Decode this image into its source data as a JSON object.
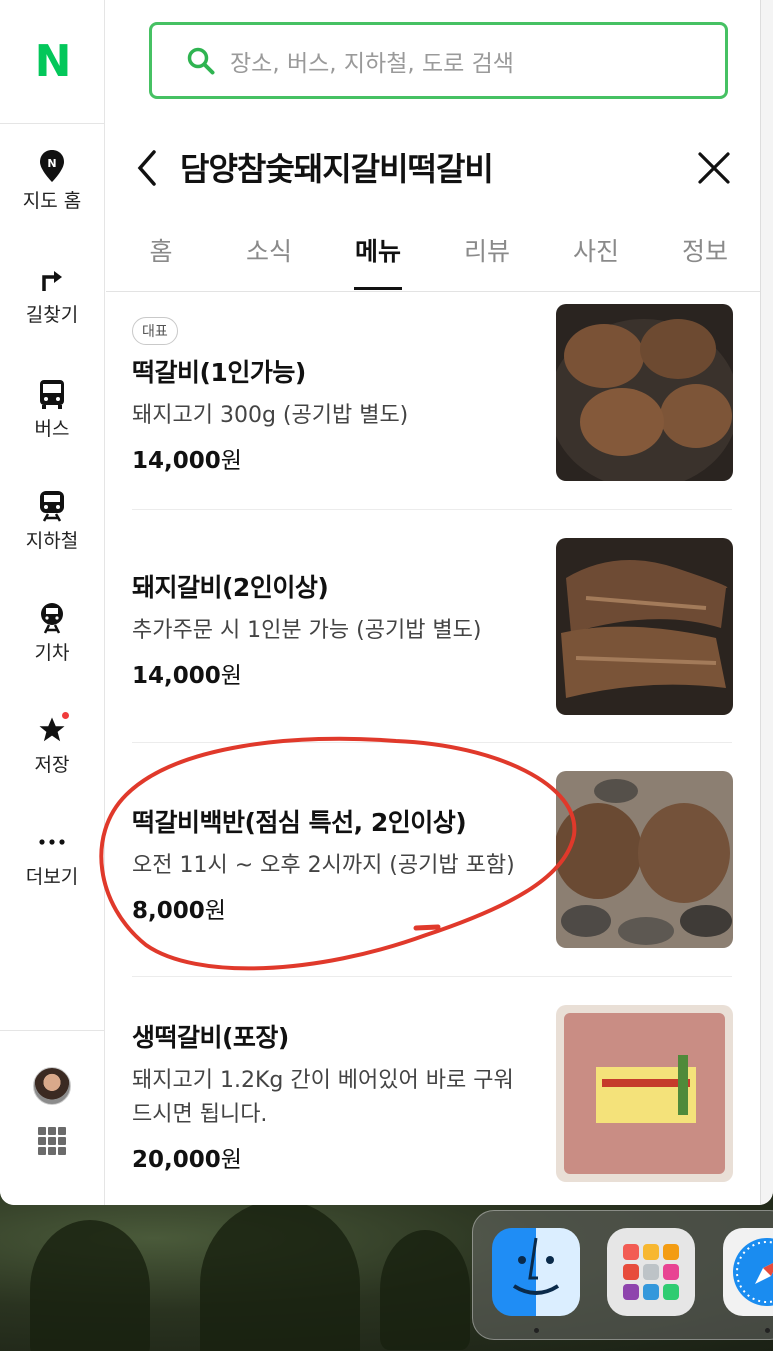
{
  "app": {
    "logo": "N",
    "accent": "#03c75a"
  },
  "search": {
    "placeholder": "장소, 버스, 지하철, 도로 검색"
  },
  "sidebar": {
    "items": [
      {
        "label": "지도 홈",
        "icon": "map-pin-icon"
      },
      {
        "label": "길찾기",
        "icon": "directions-icon"
      },
      {
        "label": "버스",
        "icon": "bus-icon"
      },
      {
        "label": "지하철",
        "icon": "subway-icon"
      },
      {
        "label": "기차",
        "icon": "train-icon"
      },
      {
        "label": "저장",
        "icon": "star-icon"
      },
      {
        "label": "더보기",
        "icon": "more-icon"
      }
    ]
  },
  "place": {
    "title": "담양참숯돼지갈비떡갈비"
  },
  "tabs": [
    {
      "label": "홈"
    },
    {
      "label": "소식"
    },
    {
      "label": "메뉴",
      "active": true
    },
    {
      "label": "리뷰"
    },
    {
      "label": "사진"
    },
    {
      "label": "정보"
    }
  ],
  "menu": [
    {
      "badge": "대표",
      "name": "떡갈비(1인가능)",
      "desc": "돼지고기 300g (공기밥 별도)",
      "price": "14,000",
      "unit": "원"
    },
    {
      "name": "돼지갈비(2인이상)",
      "desc": "추가주문 시 1인분 가능 (공기밥 별도)",
      "price": "14,000",
      "unit": "원"
    },
    {
      "name": "떡갈비백반(점심 특선, 2인이상)",
      "desc": "오전 11시 ~ 오후 2시까지 (공기밥 포함)",
      "price": "8,000",
      "unit": "원"
    },
    {
      "name": "생떡갈비(포장)",
      "desc": "돼지고기 1.2Kg 간이 베어있어 바로 구워 드시면 됩니다.",
      "price": "20,000",
      "unit": "원"
    }
  ],
  "annotation": {
    "color": "#e0392b"
  }
}
